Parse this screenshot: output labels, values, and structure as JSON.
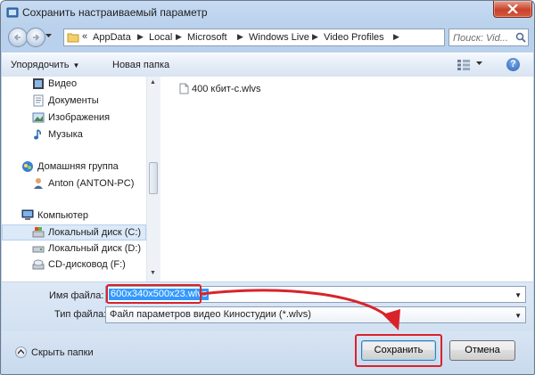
{
  "window": {
    "title": "Сохранить настраиваемый параметр"
  },
  "address": {
    "prefix": "«",
    "crumbs": [
      "AppData",
      "Local",
      "Microsoft",
      "Windows Live",
      "Video Profiles"
    ],
    "search_placeholder": "Поиск: Vid..."
  },
  "toolbar": {
    "organize_label": "Упорядочить",
    "new_folder_label": "Новая папка"
  },
  "nav_pane": {
    "items": [
      {
        "label": "Видео",
        "icon": "video-library-icon"
      },
      {
        "label": "Документы",
        "icon": "documents-library-icon"
      },
      {
        "label": "Изображения",
        "icon": "pictures-library-icon"
      },
      {
        "label": "Музыка",
        "icon": "music-library-icon"
      },
      {
        "label": "Домашняя группа",
        "icon": "homegroup-icon"
      },
      {
        "label": "Anton (ANTON-PC)",
        "icon": "user-icon"
      },
      {
        "label": "Компьютер",
        "icon": "computer-icon"
      },
      {
        "label": "Локальный диск (C:)",
        "icon": "system-drive-icon",
        "selected": true
      },
      {
        "label": "Локальный диск (D:)",
        "icon": "drive-icon"
      },
      {
        "label": "CD-дисковод (F:)",
        "icon": "cd-drive-icon"
      }
    ]
  },
  "files": [
    {
      "name": "400 кбит-с.wlvs",
      "icon": "file-icon"
    }
  ],
  "form": {
    "filename_label": "Имя файла:",
    "filename_value": "600x340x500x23.wlvs",
    "filetype_label": "Тип файла:",
    "filetype_value": "Файл параметров видео Киностудии (*.wlvs)"
  },
  "footer": {
    "hide_folders_label": "Скрыть папки",
    "save_label": "Сохранить",
    "cancel_label": "Отмена"
  },
  "colors": {
    "annotation": "#d9232a",
    "selection": "#3399ff",
    "window_chrome": "#b9d1ec"
  }
}
